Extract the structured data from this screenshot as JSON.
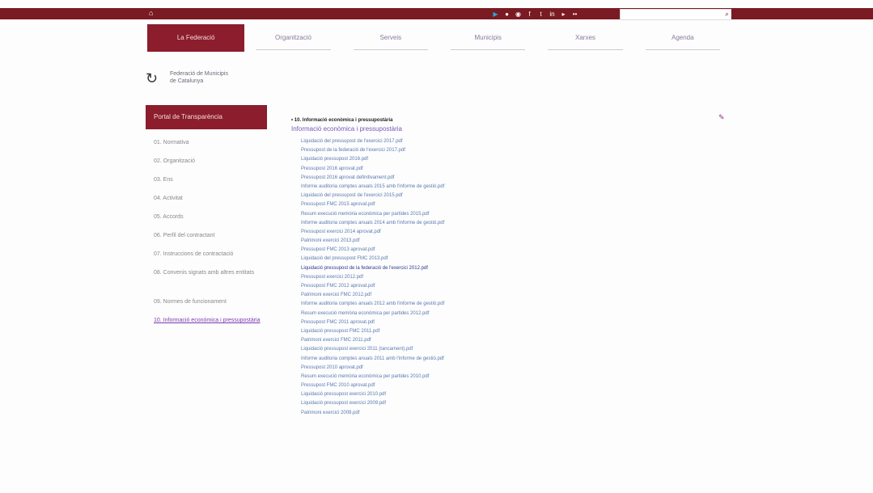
{
  "topbar": {
    "home_icon": "home-icon",
    "social_icons": [
      "google-play-icon",
      "apple-icon",
      "rss-icon",
      "facebook-icon",
      "twitter-icon",
      "linkedin-icon",
      "youtube-icon",
      "flickr-icon"
    ],
    "search": {
      "value": "",
      "icon": "search-icon"
    },
    "brand_color": "#7a1a22"
  },
  "nav": {
    "tabs": [
      {
        "label": "La Federació",
        "active": true
      },
      {
        "label": "Organització",
        "active": false
      },
      {
        "label": "Serveis",
        "active": false
      },
      {
        "label": "Municipis",
        "active": false
      },
      {
        "label": "Xarxes",
        "active": false
      },
      {
        "label": "Agenda",
        "active": false
      }
    ],
    "active_color": "#8b1d2c"
  },
  "logo": {
    "line1": "Federació de Municipis",
    "line2": "de Catalunya"
  },
  "sidebar": {
    "title": "Portal de Transparència",
    "items": [
      {
        "label": "01. Normativa"
      },
      {
        "label": "02. Organització"
      },
      {
        "label": "03. Ens"
      },
      {
        "label": "04. Activitat"
      },
      {
        "label": "05. Accords"
      },
      {
        "label": "06. Perfil del contractant"
      },
      {
        "label": "07. Instruccions de contractació"
      },
      {
        "label": "08. Convenis signats amb altres entitats"
      },
      {
        "label": "09. Normes de funcionament"
      },
      {
        "label": "10. Informació econòmica i pressupostària"
      }
    ]
  },
  "content": {
    "heading": "• 10. Informació econòmica i pressupostària",
    "subheading": "Informació econòmica i pressupostària",
    "files": [
      "Liquidació del pressupost de l'exercici 2017.pdf",
      "Pressupost de la federació de l'exercici 2017.pdf",
      "Liquidació pressupost 2016.pdf",
      "Pressupost 2016 aprovat.pdf",
      "Pressupost 2016 aprovat definitivament.pdf",
      "Informe auditoria comptes anuals 2015 amb l'informe de gestió.pdf",
      "Liquidació del pressupost de l'exercici 2015.pdf",
      "Pressupost FMC 2015 aprovat.pdf",
      "Resum execució memòria econòmica per partides 2015.pdf",
      "Informe auditoria comptes anuals 2014 amb l'informe de gestió.pdf",
      "Pressupost exercici 2014 aprovat.pdf",
      "Patrimoni exercici 2013.pdf",
      "Pressupost FMC 2013 aprovat.pdf",
      "Liquidació del pressupost FMC 2013.pdf",
      "Liquidació pressupost de la federació de l'exercici 2012.pdf",
      "Pressupost exercici 2012.pdf",
      "Pressupost FMC 2012 aprovat.pdf",
      "Patrimoni exercici FMC 2012.pdf",
      "Informe auditoria comptes anuals 2012 amb l'informe de gestió.pdf",
      "Resum execució memòria econòmica per partides 2012.pdf",
      "Pressupost FMC 2011 aprovat.pdf",
      "Liquidació pressupost FMC 2011.pdf",
      "Patrimoni exercici FMC 2011.pdf",
      "Liquidació pressupost exercici 2011 (tancament).pdf",
      "Informe auditoria comptes anuals 2011 amb l'informe de gestió.pdf",
      "Pressupost 2010 aprovat.pdf",
      "Resum execució memòria econòmica per partides 2010.pdf",
      "Pressupost FMC 2010 aprovat.pdf",
      "Liquidació pressupost exercici 2010.pdf",
      "Liquidació pressupost exercici 2009.pdf",
      "Patrimoni exercici 2009.pdf"
    ]
  }
}
